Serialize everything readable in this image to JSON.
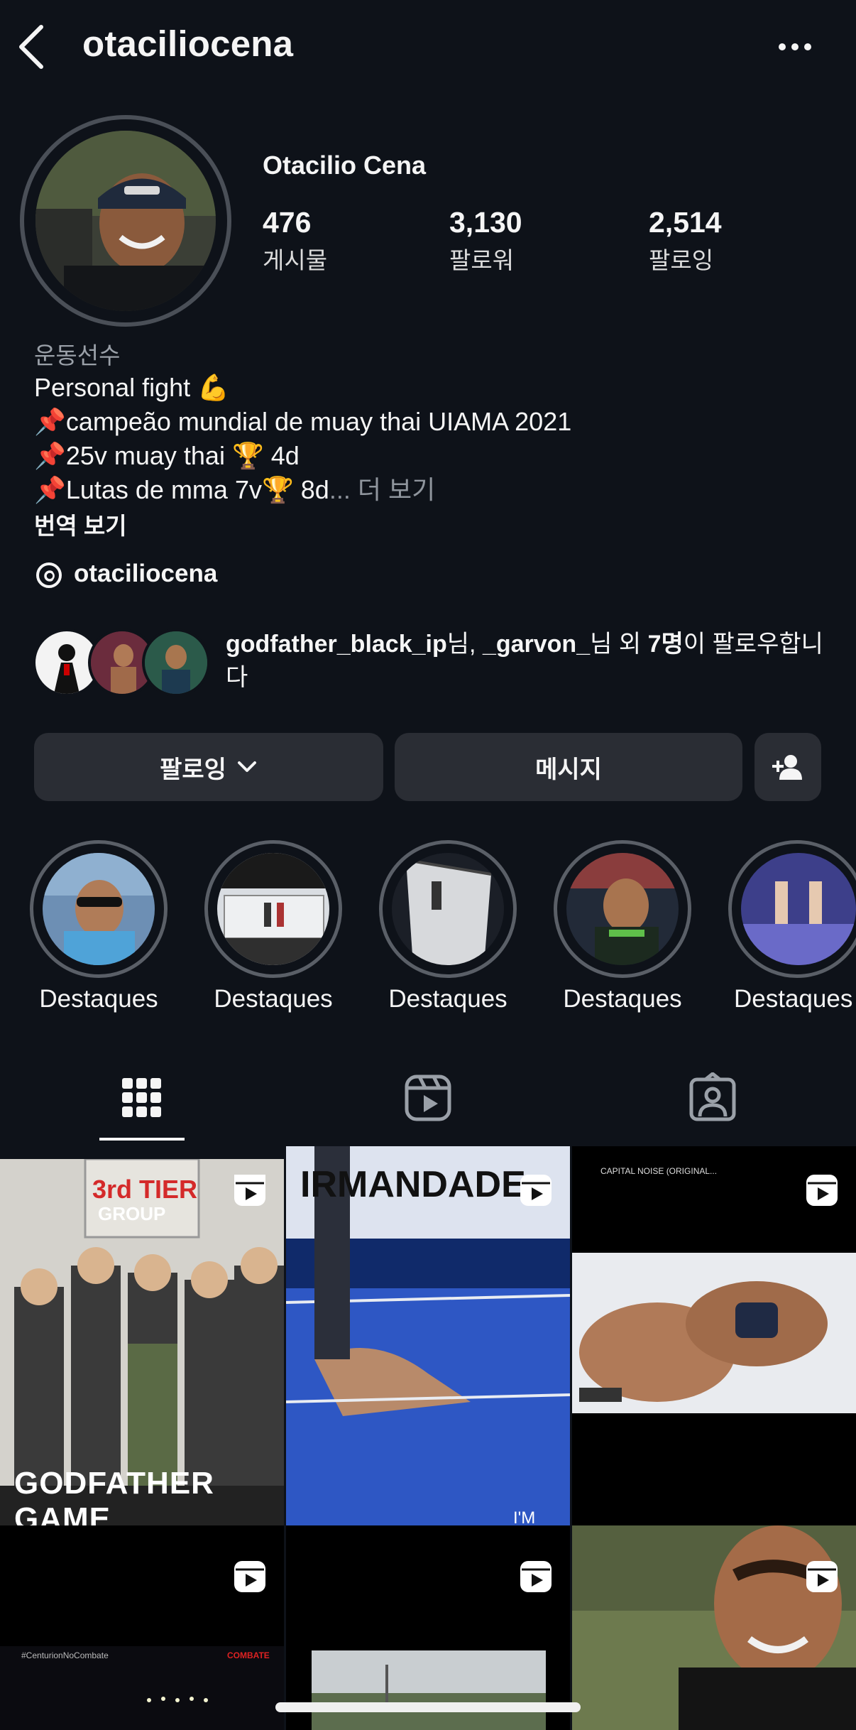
{
  "header": {
    "username": "otaciliocena"
  },
  "profile": {
    "display_name": "Otacilio Cena",
    "stats": [
      {
        "value": "476",
        "label": "게시물"
      },
      {
        "value": "3,130",
        "label": "팔로워"
      },
      {
        "value": "2,514",
        "label": "팔로잉"
      }
    ],
    "category": "운동선수",
    "bio_lines": [
      "Personal fight 💪",
      "📌campeão mundial de muay thai UIAMA 2021",
      "📌25v muay thai 🏆 4d",
      "📌Lutas de mma 7v🏆 8d"
    ],
    "bio_ellipsis": "...",
    "bio_more": "더 보기",
    "translate": "번역 보기",
    "threads_handle": "otaciliocena"
  },
  "followed_by": {
    "user1": "godfather_black_ip",
    "suffix1": "님, ",
    "user2": "_garvon_",
    "suffix2": "님 외 ",
    "count": "7명",
    "tail": "이 팔로우합니다"
  },
  "buttons": {
    "following": "팔로잉",
    "message": "메시지"
  },
  "highlights": [
    "Destaques",
    "Destaques",
    "Destaques",
    "Destaques",
    "Destaques"
  ],
  "posts": {
    "p1_top": "3rd TIER",
    "p1_group": "GROUP",
    "p1_bottom": "GODFATHER GAME",
    "p2_text": "IRMANDADE",
    "p2_bottom": "I'M",
    "p3_caption": "CAPITAL NOISE (ORIGINAL...",
    "p4_caption": "#CenturionNoCombate",
    "p4_brand": "COMBATE"
  },
  "icons": [
    "chevron-left-icon",
    "more-dots-icon",
    "threads-icon",
    "chevron-down-icon",
    "add-person-icon",
    "grid-icon",
    "reels-icon",
    "tagged-icon",
    "reel-badge-icon"
  ],
  "colors": {
    "background": "#0e1219",
    "button": "#2a2d34",
    "text": "#f5f5f5",
    "muted": "#8f959d"
  }
}
